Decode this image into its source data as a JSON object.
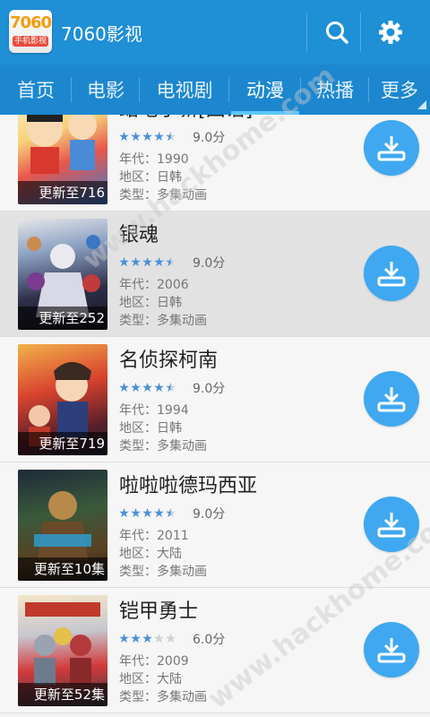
{
  "header": {
    "logo_main": "7060",
    "logo_sub": "手机影视",
    "title": "7060影视",
    "search_icon": "search-icon",
    "settings_icon": "gear-icon"
  },
  "tabs": [
    {
      "label": "首页",
      "active": false
    },
    {
      "label": "电影",
      "active": false
    },
    {
      "label": "电视剧",
      "active": false
    },
    {
      "label": "动漫",
      "active": true
    },
    {
      "label": "热播",
      "active": false
    },
    {
      "label": "更多",
      "active": false
    }
  ],
  "items": [
    {
      "title": "蜡笔小新[国语]",
      "score": "9.0分",
      "stars": 4.5,
      "year": "年代：1990",
      "region": "地区：日韩",
      "type": "类型：多集动画",
      "update": "更新至716",
      "highlight": false
    },
    {
      "title": "银魂",
      "score": "9.0分",
      "stars": 4.5,
      "year": "年代：2006",
      "region": "地区：日韩",
      "type": "类型：多集动画",
      "update": "更新至252",
      "highlight": true
    },
    {
      "title": "名侦探柯南",
      "score": "9.0分",
      "stars": 4.5,
      "year": "年代：1994",
      "region": "地区：日韩",
      "type": "类型：多集动画",
      "update": "更新至719",
      "highlight": false
    },
    {
      "title": "啦啦啦德玛西亚",
      "score": "9.0分",
      "stars": 4.5,
      "year": "年代：2011",
      "region": "地区：大陆",
      "type": "类型：多集动画",
      "update": "更新至10集",
      "highlight": false
    },
    {
      "title": "铠甲勇士",
      "score": "6.0分",
      "stars": 3,
      "year": "年代：2009",
      "region": "地区：大陆",
      "type": "类型：多集动画",
      "update": "更新至52集",
      "highlight": false
    }
  ],
  "colors": {
    "header_bg": "#1f8fd6",
    "tab_bg": "#1c87cf",
    "tab_indicator": "#5cc7ff",
    "star_blue": "#4a90d9",
    "download_bg": "#3fa8f0"
  },
  "watermark": "www.hackhome.com"
}
